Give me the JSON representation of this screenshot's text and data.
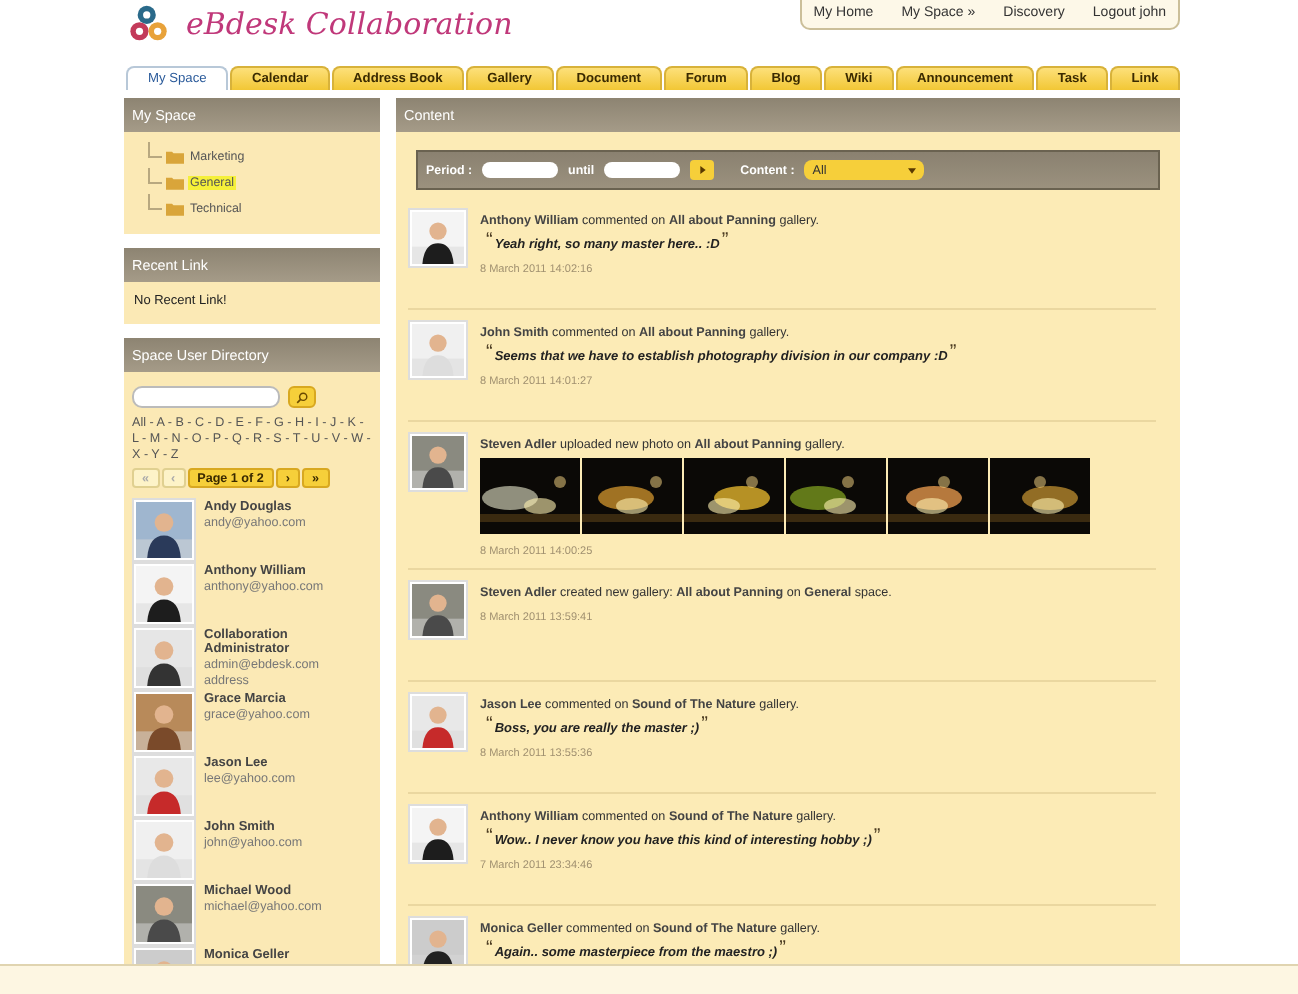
{
  "logo": {
    "text": "eBdesk Collaboration"
  },
  "top_nav": [
    {
      "label": "My Home"
    },
    {
      "label": "My Space »"
    },
    {
      "label": "Discovery"
    },
    {
      "label": "Logout john"
    }
  ],
  "tabs": [
    {
      "label": "My Space",
      "selected": true
    },
    {
      "label": "Calendar",
      "selected": false
    },
    {
      "label": "Address Book",
      "selected": false
    },
    {
      "label": "Gallery",
      "selected": false
    },
    {
      "label": "Document",
      "selected": false
    },
    {
      "label": "Forum",
      "selected": false
    },
    {
      "label": "Blog",
      "selected": false
    },
    {
      "label": "Wiki",
      "selected": false
    },
    {
      "label": "Announcement",
      "selected": false
    },
    {
      "label": "Task",
      "selected": false
    },
    {
      "label": "Link",
      "selected": false
    }
  ],
  "sidebar": {
    "my_space": {
      "title": "My Space",
      "items": [
        {
          "label": "Marketing",
          "selected": false
        },
        {
          "label": "General",
          "selected": true
        },
        {
          "label": "Technical",
          "selected": false
        }
      ]
    },
    "recent_link": {
      "title": "Recent Link",
      "text": "No Recent Link!"
    },
    "directory": {
      "title": "Space User Directory",
      "letters": "All - A - B - C - D - E - F - G - H - I - J - K - L - M - N - O - P - Q - R - S - T - U - V - W - X - Y - Z",
      "pager": [
        {
          "label": "«",
          "disabled": true
        },
        {
          "label": "‹",
          "disabled": true
        },
        {
          "label": "Page 1 of 2",
          "disabled": false
        },
        {
          "label": "›",
          "disabled": false
        },
        {
          "label": "»",
          "disabled": false
        }
      ],
      "users": [
        {
          "name": "Andy Douglas",
          "email": "andy@yahoo.com"
        },
        {
          "name": "Anthony William",
          "email": "anthony@yahoo.com"
        },
        {
          "name": "Collaboration Administrator",
          "email": "admin@ebdesk.com",
          "address": "address"
        },
        {
          "name": "Grace Marcia",
          "email": "grace@yahoo.com"
        },
        {
          "name": "Jason Lee",
          "email": "lee@yahoo.com"
        },
        {
          "name": "John Smith",
          "email": "john@yahoo.com"
        },
        {
          "name": "Michael Wood",
          "email": "michael@yahoo.com"
        },
        {
          "name": "Monica Geller"
        }
      ]
    }
  },
  "content": {
    "title": "Content",
    "filter": {
      "period_label": "Period :",
      "until_label": "until",
      "content_label": "Content :",
      "content_value": "All"
    },
    "feed": [
      {
        "text": "**Anthony William** commented on **All about Panning** gallery.",
        "quote_open": "“",
        "quote": "Yeah right, so many master here.. :D",
        "quote_close": "”",
        "time": "8 March 2011 14:02:16"
      },
      {
        "text": "**John Smith** commented on **All about Panning** gallery.",
        "quote_open": "“",
        "quote": "Seems that we have to establish photography division in our company :D",
        "quote_close": "”",
        "time": "8 March 2011 14:01:27"
      },
      {
        "text": "**Steven Adler** uploaded new photo on **All about Panning** gallery.",
        "time": "8 March 2011 14:00:25"
      },
      {
        "text": "**Steven Adler** created new gallery: **All about Panning** on **General** space.",
        "time": "8 March 2011 13:59:41"
      },
      {
        "text": "**Jason Lee** commented on **Sound of The Nature** gallery.",
        "quote_open": "“",
        "quote": "Boss, you are really the master ;)",
        "quote_close": "”",
        "time": "8 March 2011 13:55:36"
      },
      {
        "text": "**Anthony William** commented on **Sound of The Nature** gallery.",
        "quote_open": "“",
        "quote": "Wow.. I never know you have this kind of interesting hobby ;)",
        "quote_close": "”",
        "time": "7 March 2011 23:34:46"
      },
      {
        "text": "**Monica Geller** commented on **Sound of The Nature** gallery.",
        "quote_open": "“",
        "quote": "Again.. some masterpiece from the maestro ;)",
        "quote_close": "”"
      }
    ]
  }
}
